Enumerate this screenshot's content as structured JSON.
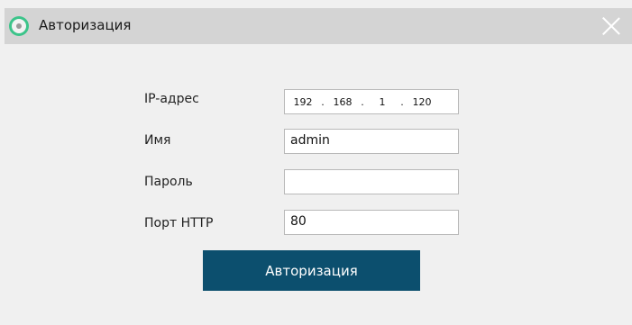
{
  "window": {
    "title": "Авторизация"
  },
  "form": {
    "ip_label": "IP-адрес",
    "ip_octets": [
      "192",
      "168",
      "1",
      "120"
    ],
    "ip_separator": ".",
    "name_label": "Имя",
    "name_value": "admin",
    "password_label": "Пароль",
    "password_value": "",
    "port_label": "Порт HTTP",
    "port_value": "80"
  },
  "buttons": {
    "login_label": "Авторизация"
  },
  "colors": {
    "title_bar": "#d4d4d4",
    "button": "#0c4f6e",
    "app_icon": "#3cc48a"
  }
}
